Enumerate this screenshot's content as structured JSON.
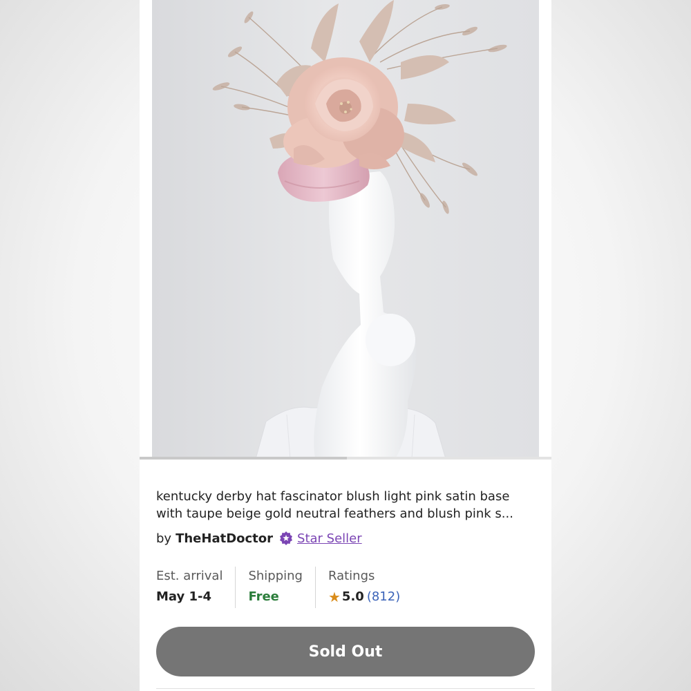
{
  "listing": {
    "title": "kentucky derby hat fascinator blush light pink satin base with  taupe beige gold neutral feathers and blush pink s...",
    "seller": {
      "prefix": "by",
      "name": "TheHatDoctor",
      "badge_label": "Star Seller",
      "badge_icon": "star-seller-icon"
    },
    "info": {
      "arrival_label": "Est. arrival",
      "arrival_value": "May 1-4",
      "shipping_label": "Shipping",
      "shipping_value": "Free",
      "ratings_label": "Ratings",
      "rating_value": "5.0",
      "rating_count": "(812)",
      "rating_icon": "star-icon"
    },
    "button_label": "Sold Out"
  },
  "colors": {
    "star_seller": "#7b45b4",
    "shipping_free": "#2a7d3a",
    "rating_star": "#d98c1a",
    "rating_count": "#3a62b8",
    "button_bg": "#757575"
  }
}
